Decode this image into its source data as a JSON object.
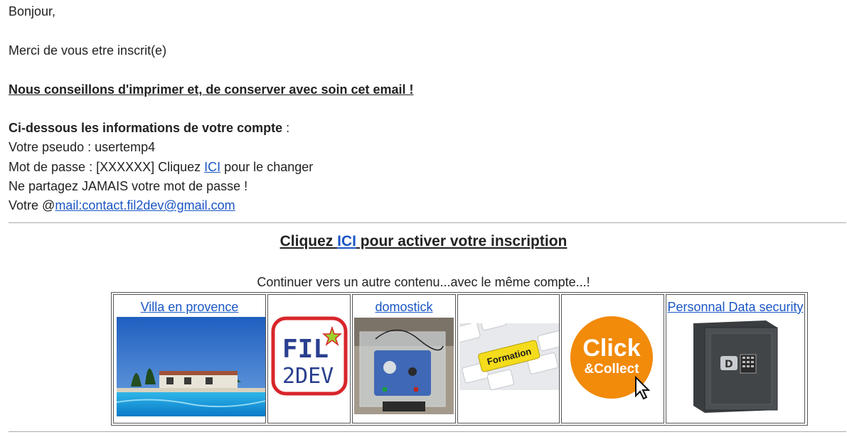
{
  "greeting": "Bonjour,",
  "thanks": "Merci de vous etre inscrit(e)",
  "advice": "Nous conseillons d'imprimer et, de conserver avec soin cet email !",
  "account": {
    "header": "Ci-dessous les informations de votre compte",
    "header_colon": " :",
    "pseudo": "Votre pseudo : usertemp4",
    "password_prefix": "Mot de passe : [XXXXXX] Cliquez ",
    "password_link": "ICI",
    "password_suffix": " pour le changer",
    "share_warning": "Ne partagez JAMAIS votre mot de passe !",
    "email_prefix": "Votre @",
    "email_link": "mail:contact.fil2dev@gmail.com"
  },
  "activate": {
    "prefix": "Cliquez ",
    "link": "ICI",
    "suffix": " pour activer votre inscription"
  },
  "continue_text": "Continuer vers un autre contenu...avec le même compte...!",
  "tiles": [
    {
      "caption": "Villa en provence",
      "image": "villa-pool-photo"
    },
    {
      "caption": "",
      "image": "fil2dev-logo",
      "logo_text_1": "FIL",
      "logo_text_2": "2DEV"
    },
    {
      "caption": "domostick",
      "image": "domostick-device-photo"
    },
    {
      "caption": "",
      "image": "formation-keyboard-photo",
      "key_text": "Formation"
    },
    {
      "caption": "",
      "image": "click-collect-logo",
      "logo_text_1": "Click",
      "logo_text_2": "&Collect"
    },
    {
      "caption": "Personnal Data security",
      "image": "safe-photo"
    }
  ]
}
